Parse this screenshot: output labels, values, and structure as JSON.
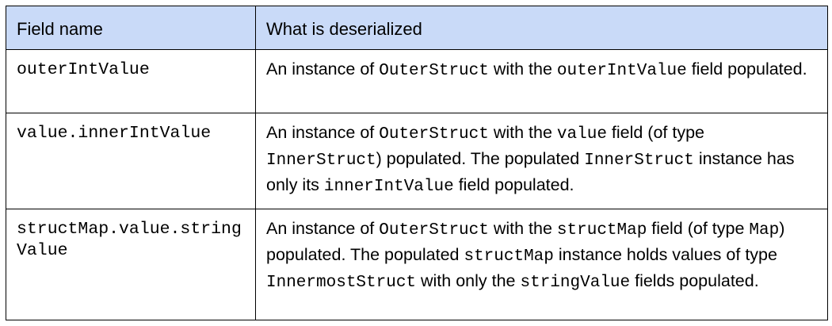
{
  "table": {
    "headers": {
      "field": "Field name",
      "desc": "What is deserialized"
    },
    "rows": [
      {
        "field": "outerIntValue",
        "desc": [
          {
            "t": "An instance of "
          },
          {
            "c": "OuterStruct"
          },
          {
            "t": " with the "
          },
          {
            "c": "outerIntValue"
          },
          {
            "t": " field populated."
          }
        ]
      },
      {
        "field": "value.innerIntValue",
        "desc": [
          {
            "t": "An instance of "
          },
          {
            "c": "OuterStruct"
          },
          {
            "t": " with the "
          },
          {
            "c": "value"
          },
          {
            "t": " field (of type "
          },
          {
            "c": "InnerStruct"
          },
          {
            "t": ") populated. The populated "
          },
          {
            "c": "InnerStruct"
          },
          {
            "t": " instance has only its "
          },
          {
            "c": "innerIntValue"
          },
          {
            "t": " field populated."
          }
        ]
      },
      {
        "field": "structMap.value.stringValue",
        "desc": [
          {
            "t": "An instance of "
          },
          {
            "c": "OuterStruct"
          },
          {
            "t": " with the "
          },
          {
            "c": "structMap"
          },
          {
            "t": " field (of type "
          },
          {
            "c": "Map"
          },
          {
            "t": ") populated. The populated "
          },
          {
            "c": "structMap"
          },
          {
            "t": "  instance holds values of type "
          },
          {
            "c": "InnermostStruct"
          },
          {
            "t": " with only the "
          },
          {
            "c": "stringValue"
          },
          {
            "t": " fields populated."
          }
        ]
      }
    ]
  }
}
